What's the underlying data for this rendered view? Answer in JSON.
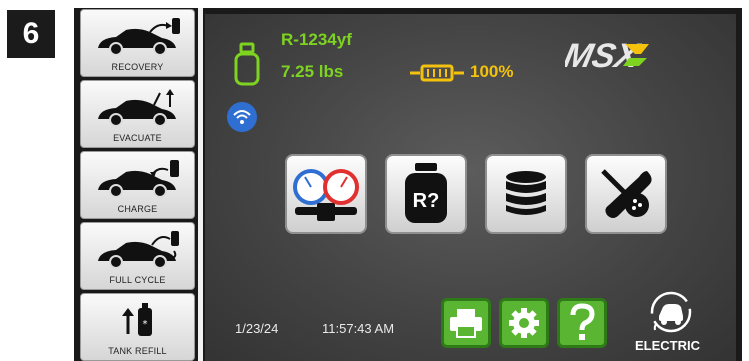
{
  "step_number": "6",
  "sidebar": {
    "items": [
      {
        "label": "RECOVERY"
      },
      {
        "label": "EVACUATE"
      },
      {
        "label": "CHARGE"
      },
      {
        "label": "FULL CYCLE"
      },
      {
        "label": "TANK REFILL"
      }
    ]
  },
  "status": {
    "refrigerant": "R-1234yf",
    "weight": "7.25 lbs",
    "battery": "100%"
  },
  "logo": "MSX",
  "tank_button_label": "R?",
  "footer": {
    "date": "1/23/24",
    "time": "11:57:43 AM",
    "mode": "ELECTRIC"
  },
  "colors": {
    "accent_green": "#7ed321",
    "battery_yellow": "#f4c20d",
    "wifi_blue": "#2f6fd1",
    "button_green": "#5ab533"
  }
}
